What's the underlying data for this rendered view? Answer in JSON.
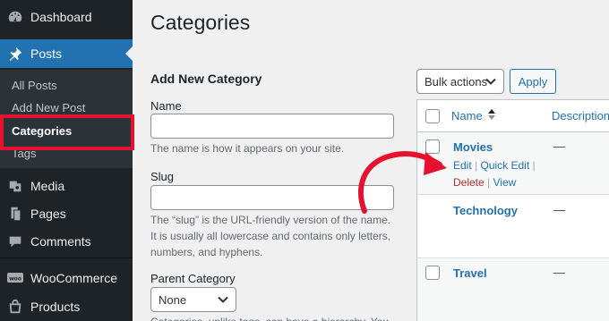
{
  "sidebar": {
    "items": [
      {
        "label": "Dashboard",
        "icon": "dashboard-icon"
      },
      {
        "label": "Posts",
        "icon": "pin-icon"
      },
      {
        "label": "Media",
        "icon": "media-icon"
      },
      {
        "label": "Pages",
        "icon": "pages-icon"
      },
      {
        "label": "Comments",
        "icon": "comments-icon"
      },
      {
        "label": "WooCommerce",
        "icon": "woocommerce-icon"
      },
      {
        "label": "Products",
        "icon": "products-icon"
      }
    ],
    "submenu": [
      "All Posts",
      "Add New Post",
      "Categories",
      "Tags"
    ]
  },
  "page": {
    "title": "Categories"
  },
  "form": {
    "title": "Add New Category",
    "name_label": "Name",
    "name_value": "",
    "name_help": "The name is how it appears on your site.",
    "slug_label": "Slug",
    "slug_value": "",
    "slug_help_1": "The “slug” is the URL-friendly version of the name.",
    "slug_help_2": "It is usually all lowercase and contains only letters,",
    "slug_help_3": "numbers, and hyphens.",
    "parent_label": "Parent Category",
    "parent_value": "None",
    "parent_help": "Categories, unlike tags, can have a hierarchy. You"
  },
  "toolbar": {
    "bulk_actions": "Bulk actions",
    "apply": "Apply"
  },
  "table": {
    "columns": [
      "Name",
      "Description"
    ],
    "rows": [
      {
        "name": "Movies",
        "description": "—"
      },
      {
        "name": "Technology",
        "description": "—"
      },
      {
        "name": "Travel",
        "description": "—"
      }
    ],
    "row_actions": {
      "edit": "Edit",
      "quick_edit": "Quick Edit",
      "delete": "Delete",
      "view": "View",
      "sep": "|"
    }
  },
  "colors": {
    "sidebar_bg": "#1d2327",
    "accent": "#2271b1",
    "highlight": "#e5112f"
  }
}
